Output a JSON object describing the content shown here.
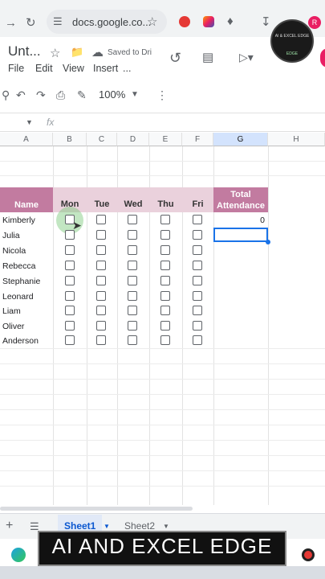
{
  "browser": {
    "url": "docs.google.co...",
    "back_icon": "arrow-right-icon",
    "reload_icon": "reload-icon"
  },
  "logo": {
    "line1": "AI & EXCEL EDGE",
    "line2": "EDGE"
  },
  "doc": {
    "title": "Unt...",
    "saved_status": "Saved to Dri",
    "menu": [
      "File",
      "Edit",
      "View",
      "Insert",
      "..."
    ]
  },
  "toolbar": {
    "zoom": "100%"
  },
  "formula_bar": {
    "fx_label": "fx"
  },
  "sheet": {
    "columns": [
      "A",
      "B",
      "C",
      "D",
      "E",
      "F",
      "G",
      "H"
    ],
    "header_name": "Name",
    "days": [
      "Mon",
      "Tue",
      "Wed",
      "Thu",
      "Fri"
    ],
    "total_header_line1": "Total",
    "total_header_line2": "Attendance",
    "rows": [
      {
        "name": "Kimberly",
        "total": "0"
      },
      {
        "name": "Julia",
        "total": ""
      },
      {
        "name": "Nicola",
        "total": ""
      },
      {
        "name": "Rebecca",
        "total": ""
      },
      {
        "name": "Stephanie",
        "total": ""
      },
      {
        "name": "Leonard",
        "total": ""
      },
      {
        "name": "Liam",
        "total": ""
      },
      {
        "name": "Oliver",
        "total": ""
      },
      {
        "name": "Anderson",
        "total": ""
      }
    ]
  },
  "tabs": [
    "Sheet1",
    "Sheet2"
  ],
  "banner": "AI AND EXCEL EDGE",
  "colors": {
    "header_fill": "#c27ba0",
    "day_fill": "#ead1dc",
    "selection": "#1a73e8"
  }
}
